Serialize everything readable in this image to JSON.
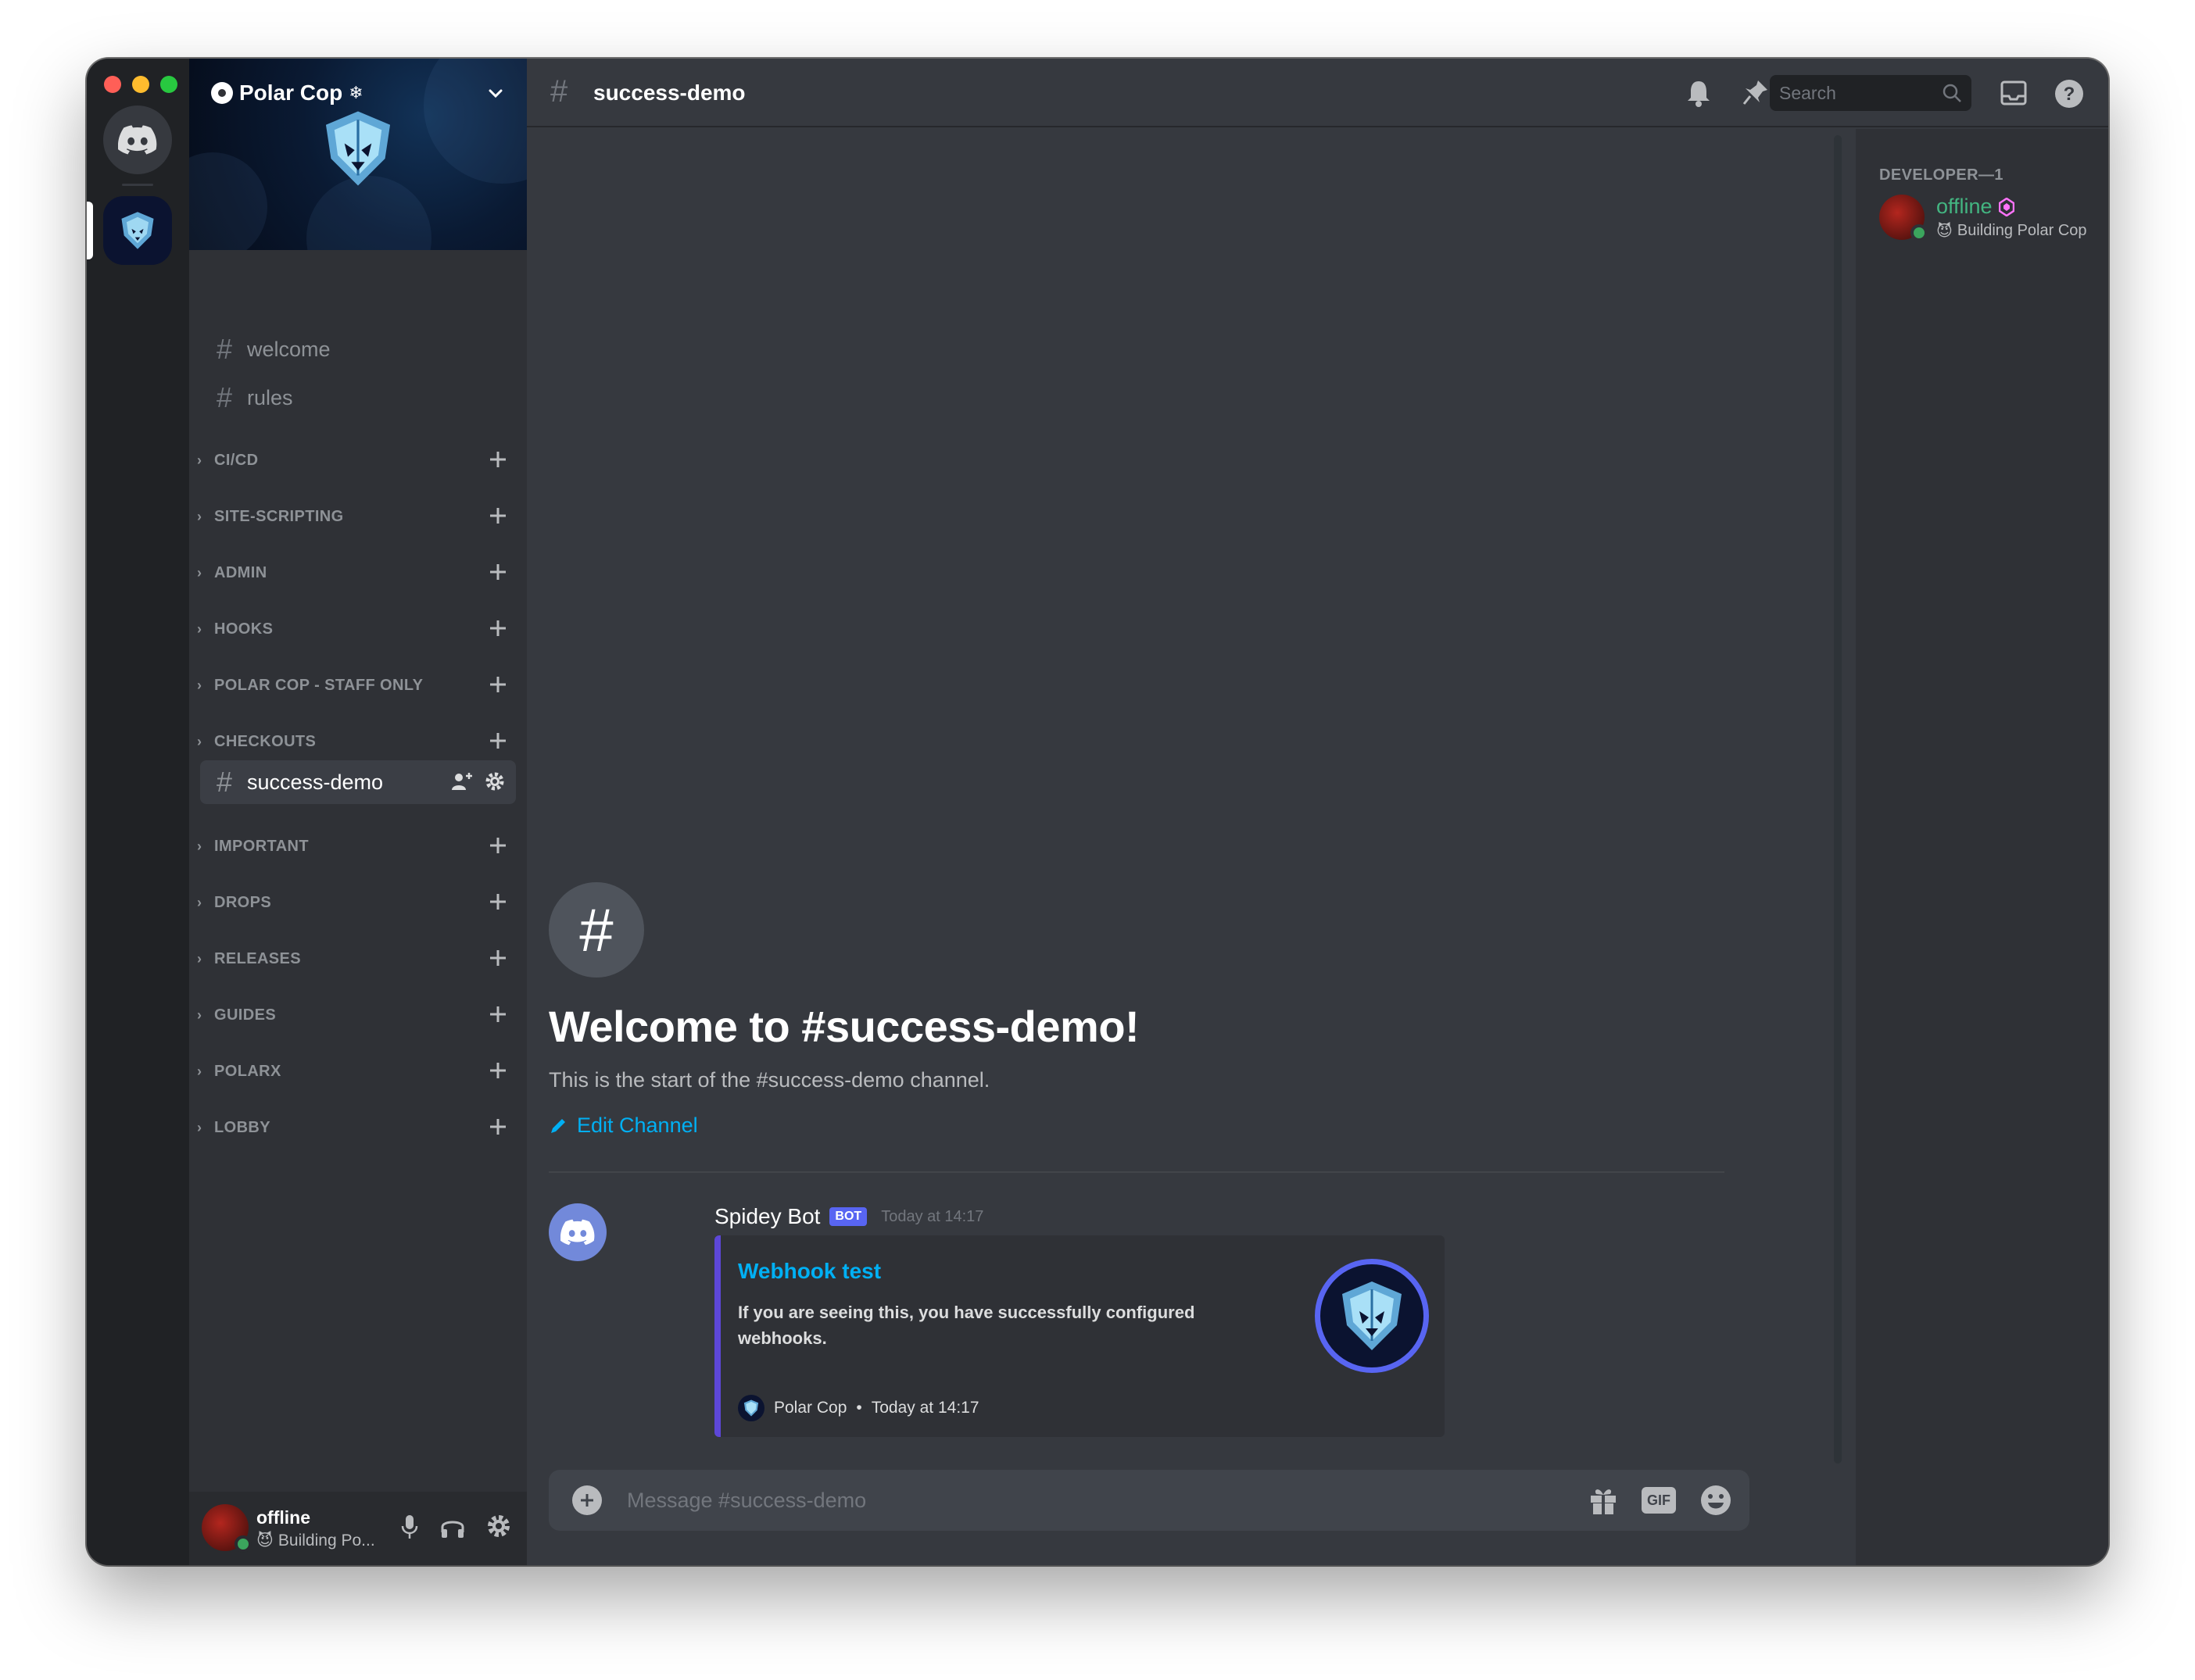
{
  "server": {
    "name": "Polar Cop",
    "name_suffix": "❄"
  },
  "channels_top": [
    {
      "label": "welcome"
    },
    {
      "label": "rules"
    }
  ],
  "categories": [
    {
      "label": "CI/CD"
    },
    {
      "label": "SITE-SCRIPTING"
    },
    {
      "label": "ADMIN"
    },
    {
      "label": "HOOKS"
    },
    {
      "label": "POLAR COP - STAFF ONLY"
    },
    {
      "label": "CHECKOUTS"
    },
    {
      "label": "IMPORTANT"
    },
    {
      "label": "DROPS"
    },
    {
      "label": "RELEASES"
    },
    {
      "label": "GUIDES"
    },
    {
      "label": "POLARX"
    },
    {
      "label": "LOBBY"
    }
  ],
  "active_channel": {
    "label": "success-demo"
  },
  "user_panel": {
    "name": "offline",
    "status": "Building Po..."
  },
  "topbar": {
    "title": "success-demo",
    "search_placeholder": "Search"
  },
  "welcome": {
    "title": "Welcome to #success-demo!",
    "subtitle": "This is the start of the #success-demo channel.",
    "edit_label": "Edit Channel"
  },
  "message": {
    "author": "Spidey Bot",
    "tag": "BOT",
    "time": "Today at 14:17",
    "embed": {
      "title": "Webhook test",
      "description": "If you are seeing this, you have successfully configured webhooks.",
      "footer_name": "Polar Cop",
      "footer_sep": "•",
      "footer_time": "Today at 14:17"
    }
  },
  "composer": {
    "placeholder": "Message #success-demo",
    "gif_label": "GIF"
  },
  "members": {
    "header": "DEVELOPER—1",
    "items": [
      {
        "name": "offline",
        "status": "Building Polar Cop"
      }
    ]
  },
  "colors": {
    "accent": "#5865f2",
    "link": "#00b0f4",
    "online": "#3ba55d",
    "member_name": "#43b581"
  }
}
